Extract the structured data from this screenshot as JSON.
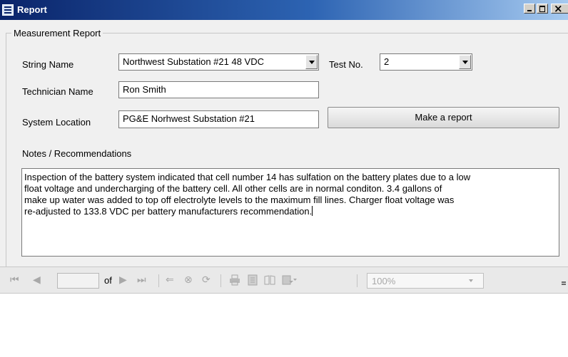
{
  "window": {
    "title": "Report",
    "icon": "report-icon",
    "controls": [
      "minimize-icon",
      "maximize-icon",
      "close-icon"
    ]
  },
  "group": {
    "title": "Measurement Report"
  },
  "form": {
    "string_name": {
      "label": "String Name",
      "value": "Northwest Substation #21 48 VDC"
    },
    "test_no": {
      "label": "Test No.",
      "value": "2"
    },
    "technician": {
      "label": "Technician Name",
      "value": "Ron Smith"
    },
    "location": {
      "label": "System Location",
      "value": "PG&E Norhwest Substation #21"
    },
    "make_report_label": "Make a report",
    "notes_label": "Notes / Recommendations",
    "notes_lines": [
      "Inspection of the battery system indicated that cell number 14 has sulfation on the battery plates due to a low",
      "float voltage and undercharging of the battery cell.  All other cells are in normal conditon.  3.4 gallons of",
      "make up water was added to top off electrolyte levels to the maximum fill lines.  Charger float voltage was",
      "re-adjusted to 133.8 VDC per battery manufacturers recommendation."
    ]
  },
  "toolbar": {
    "page_value": "",
    "of_label": "of",
    "zoom_value": "100%",
    "icons": [
      "first-page-icon",
      "previous-page-icon",
      "next-page-icon",
      "last-page-icon",
      "back-icon",
      "stop-icon",
      "refresh-icon",
      "print-icon",
      "print-layout-icon",
      "page-setup-icon",
      "export-icon"
    ]
  },
  "colors": {
    "titlebar_start": "#0a246a",
    "titlebar_end": "#a6caf0",
    "panel_bg": "#f0f0f0",
    "toolbar_bg": "#e9e9e9",
    "disabled_icon": "#a8a8a8"
  }
}
